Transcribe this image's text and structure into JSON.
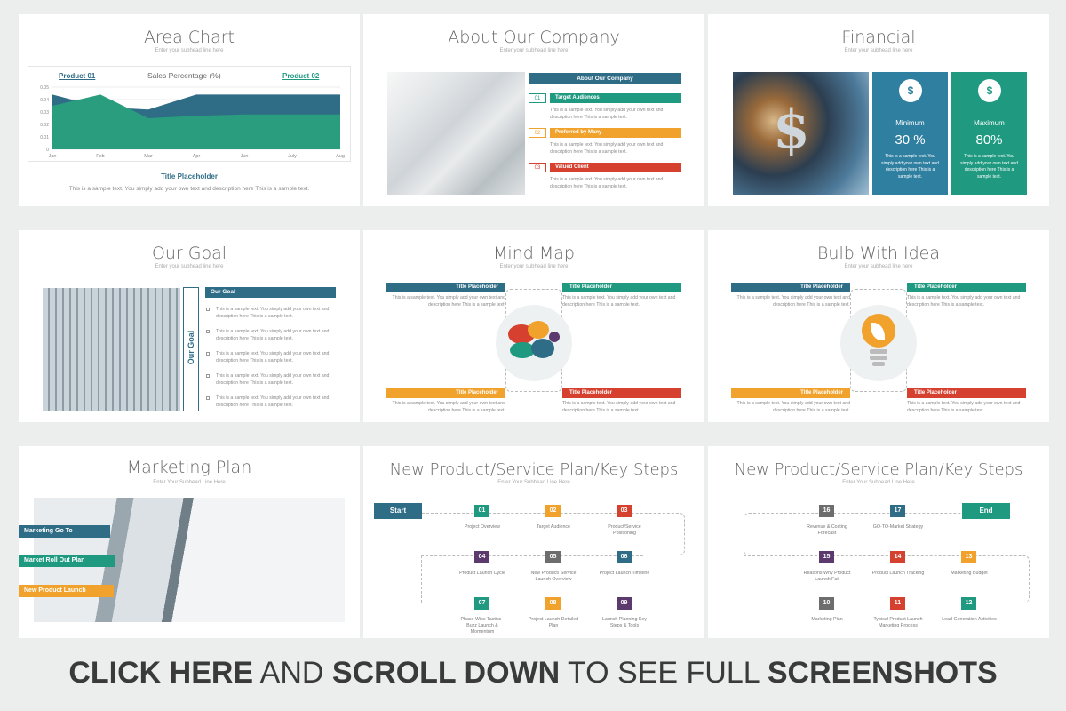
{
  "colors": {
    "teal": "#1f9a81",
    "navy": "#2f6c86",
    "orange": "#f0a22c",
    "red": "#d5402f",
    "purple": "#5c3a6e",
    "gray": "#6d6d6d"
  },
  "slides": {
    "area_chart": {
      "title": "Area Chart",
      "subhead": "Enter your subhead line here",
      "legend_left": "Product 01",
      "legend_right": "Product 02",
      "chart_title": "Sales Percentage (%)",
      "caption_title": "Title Placeholder",
      "caption_text": "This is a sample text. You simply add your own text and description here This is a sample text."
    },
    "about": {
      "title": "About Our Company",
      "subhead": "Enter your subhead line here",
      "header": "About Our Company",
      "items": [
        {
          "num": "01",
          "label": "Target Audiences",
          "text": "This is a sample text. You simply add your own text and description here This is a sample text."
        },
        {
          "num": "02",
          "label": "Preferred by Many",
          "text": "This is a sample text. You simply add your own text and description here This is a sample text."
        },
        {
          "num": "03",
          "label": "Valued Client",
          "text": "This is a sample text. You simply add your own text and description here This is a sample text."
        }
      ]
    },
    "financial": {
      "title": "Financial",
      "subhead": "Enter your subhead line here",
      "min_label": "Minimum",
      "min_value": "30 %",
      "max_label": "Maximum",
      "max_value": "80%",
      "min_text": "This is a sample text. You simply add your own text and description here This is a sample text.",
      "max_text": "This is a sample text. You simply add your own text and description here This is a sample text."
    },
    "goal": {
      "title": "Our Goal",
      "subhead": "Enter your subhead line here",
      "vertical": "Our Goal",
      "header": "Our Goal",
      "bullet": "This is a sample text. You simply add your own text and description here This is a sample text."
    },
    "mindmap": {
      "title": "Mind Map",
      "subhead": "Enter your subhead line here",
      "placeholder": "Title Placeholder",
      "text": "This is a sample text. You simply add your own text and description here This is a sample text."
    },
    "bulb": {
      "title": "Bulb With Idea",
      "subhead": "Enter your subhead line here",
      "placeholder": "Title Placeholder",
      "text": "This is a sample text. You simply add your own text and description here This is a sample text."
    },
    "marketing": {
      "title": "Marketing Plan",
      "subhead": "Enter Your Subhead Line Here",
      "b1": "Marketing Go To",
      "b2": "Market Roll Out Plan",
      "b3": "New Product Launch"
    },
    "plan1": {
      "title": "New Product/Service Plan/Key Steps",
      "subhead": "Enter Your Subhead Line Here",
      "start": "Start",
      "steps": [
        {
          "num": "01",
          "label": "Project Overview"
        },
        {
          "num": "02",
          "label": "Target Audience"
        },
        {
          "num": "03",
          "label": "Product/Service Positioning"
        },
        {
          "num": "04",
          "label": "Product Launch Cycle"
        },
        {
          "num": "05",
          "label": "New Product/ Service Launch Overview"
        },
        {
          "num": "06",
          "label": "Project Launch Timeline"
        },
        {
          "num": "07",
          "label": "Phase Wise Tactics - Buzz Launch & Momentum"
        },
        {
          "num": "08",
          "label": "Project Launch Detailed Plan"
        },
        {
          "num": "09",
          "label": "Launch Planning Key Steps & Tools"
        }
      ]
    },
    "plan2": {
      "title": "New Product/Service Plan/Key Steps",
      "subhead": "Enter Your Subhead Line Here",
      "end": "End",
      "steps": [
        {
          "num": "16",
          "label": "Revenue &       Costing Forecast"
        },
        {
          "num": "17",
          "label": "GO-TO-Market Strategy"
        },
        {
          "num": "15",
          "label": "Reasons Why Product Launch Fail"
        },
        {
          "num": "14",
          "label": "Product Launch Tracking"
        },
        {
          "num": "13",
          "label": "Marketing Budget"
        },
        {
          "num": "10",
          "label": "Marketing Plan"
        },
        {
          "num": "11",
          "label": "Typical Product Launch Marketing Process"
        },
        {
          "num": "12",
          "label": "Lead Generation Activities"
        }
      ]
    }
  },
  "banner": {
    "p1": "CLICK HERE",
    "p2": " AND ",
    "p3": "SCROLL DOWN",
    "p4": " TO SEE FULL ",
    "p5": "SCREENSHOTS"
  },
  "chart_data": {
    "type": "area",
    "title": "Sales Percentage (%)",
    "categories": [
      "Jan",
      "Feb",
      "Mar",
      "Apr",
      "Jun",
      "July",
      "Aug"
    ],
    "ylim": [
      0,
      0.05
    ],
    "yticks": [
      "0",
      "0.01",
      "0.02",
      "0.03",
      "0.04",
      "0.05"
    ],
    "series": [
      {
        "name": "Product 01",
        "values": [
          0.035,
          0.044,
          0.025,
          0.027,
          0.028,
          0.028,
          0.028
        ],
        "color": "#2a9d7f"
      },
      {
        "name": "Product 02",
        "values": [
          0.044,
          0.034,
          0.032,
          0.044,
          0.044,
          0.044,
          0.044
        ],
        "color": "#2f6c86"
      }
    ]
  }
}
